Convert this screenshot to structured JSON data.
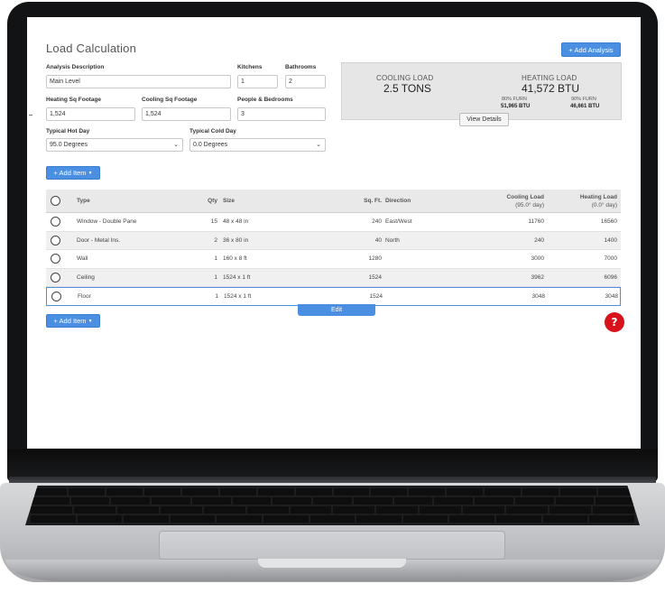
{
  "app": {
    "title": "Load Calculation",
    "add_analysis_label": "+ Add Analysis"
  },
  "form": {
    "analysis_description": {
      "label": "Analysis Description",
      "value": "Main Level"
    },
    "kitchens": {
      "label": "Kitchens",
      "value": "1"
    },
    "bathrooms": {
      "label": "Bathrooms",
      "value": "2"
    },
    "heating_sq_footage": {
      "label": "Heating Sq Footage",
      "value": "1,524"
    },
    "cooling_sq_footage": {
      "label": "Cooling Sq Footage",
      "value": "1,524"
    },
    "people_bedrooms": {
      "label": "People & Bedrooms",
      "value": "3"
    },
    "typical_hot_day": {
      "label": "Typical Hot Day",
      "value": "95.0 Degrees"
    },
    "typical_cold_day": {
      "label": "Typical Cold Day",
      "value": "0.0 Degrees"
    }
  },
  "summary": {
    "cooling_caption": "COOLING LOAD",
    "cooling_value": "2.5 TONS",
    "heating_caption": "HEATING LOAD",
    "heating_value": "41,572 BTU",
    "furn80_caption": "80% FURN",
    "furn80_value": "51,965 BTU",
    "furn90_caption": "90% FURN",
    "furn90_value": "46,661 BTU",
    "view_details_label": "View Details"
  },
  "add_item_label": "+ Add Item",
  "table": {
    "headers": {
      "type": "Type",
      "qty": "Qty",
      "size": "Size",
      "sqft": "Sq. Ft.",
      "direction": "Direction",
      "cooling_line1": "Cooling Load",
      "cooling_line2": "(95.0° day)",
      "heating_line1": "Heating Load",
      "heating_line2": "(0.0° day)"
    },
    "rows": [
      {
        "type": "Window - Double Pane",
        "qty": "15",
        "size": "48 x 48 in",
        "sqft": "240",
        "direction": "East/West",
        "cooling": "11760",
        "heating": "16560"
      },
      {
        "type": "Door - Metal Ins.",
        "qty": "2",
        "size": "36 x 80 in",
        "sqft": "40",
        "direction": "North",
        "cooling": "240",
        "heating": "1400"
      },
      {
        "type": "Wall",
        "qty": "1",
        "size": "160 x 8 ft",
        "sqft": "1280",
        "direction": "",
        "cooling": "3000",
        "heating": "7000"
      },
      {
        "type": "Ceiling",
        "qty": "1",
        "size": "1524 x 1 ft",
        "sqft": "1524",
        "direction": "",
        "cooling": "3962",
        "heating": "6096"
      },
      {
        "type": "Floor",
        "qty": "1",
        "size": "1524 x 1 ft",
        "sqft": "1524",
        "direction": "",
        "cooling": "3048",
        "heating": "3048"
      }
    ]
  },
  "edit_label": "Edit",
  "help_label": "?",
  "colors": {
    "primary": "#4a8fe2",
    "help": "#d8121a",
    "summary_bg": "#e6e6e6"
  }
}
